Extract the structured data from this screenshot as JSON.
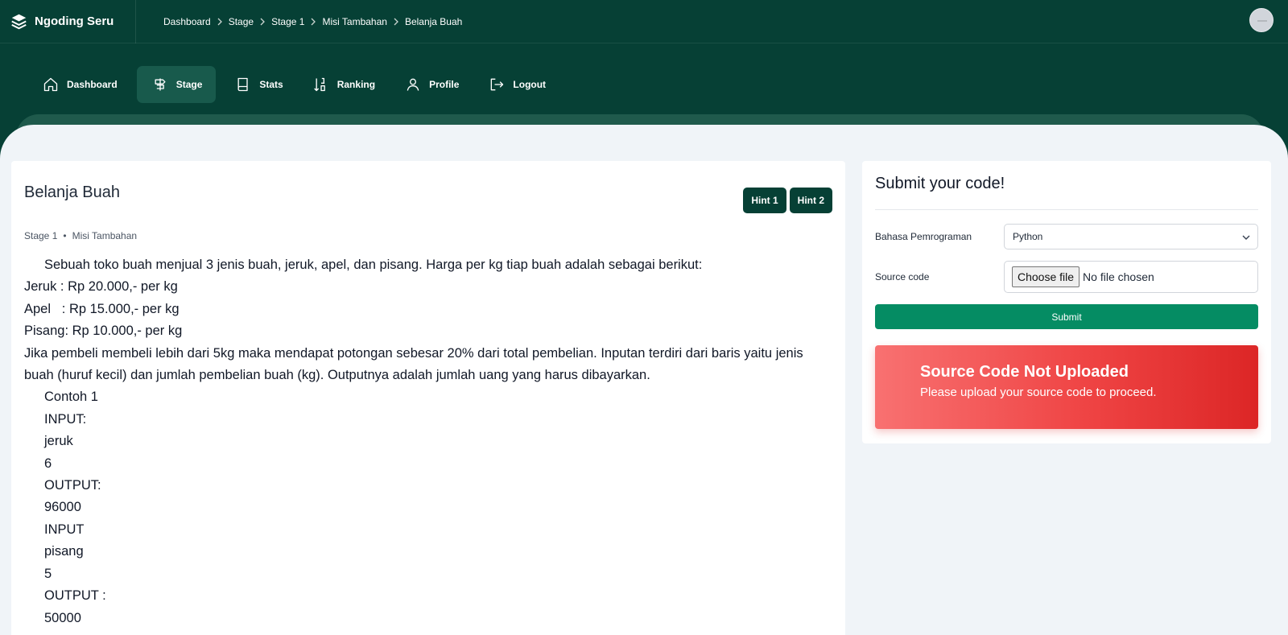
{
  "brand": {
    "name": "Ngoding Seru",
    "icon": "layers-icon"
  },
  "breadcrumb": [
    "Dashboard",
    "Stage",
    "Stage 1",
    "Misi Tambahan",
    "Belanja Buah"
  ],
  "nav": [
    {
      "label": "Dashboard",
      "icon": "home-icon",
      "active": false
    },
    {
      "label": "Stage",
      "icon": "signpost-icon",
      "active": true
    },
    {
      "label": "Stats",
      "icon": "book-icon",
      "active": false
    },
    {
      "label": "Ranking",
      "icon": "sort-numeric-icon",
      "active": false
    },
    {
      "label": "Profile",
      "icon": "user-icon",
      "active": false
    },
    {
      "label": "Logout",
      "icon": "logout-icon",
      "active": false
    }
  ],
  "problem": {
    "title": "Belanja Buah",
    "hints": [
      "Hint 1",
      "Hint 2"
    ],
    "stage": "Stage 1",
    "meta_separator": "•",
    "mission": "Misi Tambahan",
    "lines": [
      "Sebuah toko buah menjual 3 jenis buah, jeruk, apel, dan pisang. Harga per kg tiap buah adalah sebagai berikut:",
      "Jeruk : Rp 20.000,- per kg",
      "Apel   : Rp 15.000,- per kg",
      "Pisang: Rp 10.000,- per kg",
      "Jika pembeli membeli lebih dari 5kg maka mendapat potongan sebesar 20% dari total pembelian. Inputan terdiri dari baris yaitu jenis buah (huruf kecil) dan jumlah pembelian buah (kg). Outputnya adalah jumlah uang yang harus dibayarkan.",
      "Contoh 1",
      "INPUT:",
      "jeruk",
      "6",
      "OUTPUT:",
      "96000",
      "INPUT",
      "pisang",
      "5",
      "OUTPUT :",
      "50000"
    ]
  },
  "submit_panel": {
    "title": "Submit your code!",
    "language_label": "Bahasa Pemrograman",
    "language_value": "Python",
    "source_label": "Source code",
    "file_button": "Choose file",
    "file_status": "No file chosen",
    "submit_label": "Submit",
    "alert_title": "Source Code Not Uploaded",
    "alert_message": "Please upload your source code to proceed."
  },
  "colors": {
    "header": "#064035",
    "accent": "#058c63",
    "alert": "#ef4444",
    "background": "#f0f4f8"
  }
}
